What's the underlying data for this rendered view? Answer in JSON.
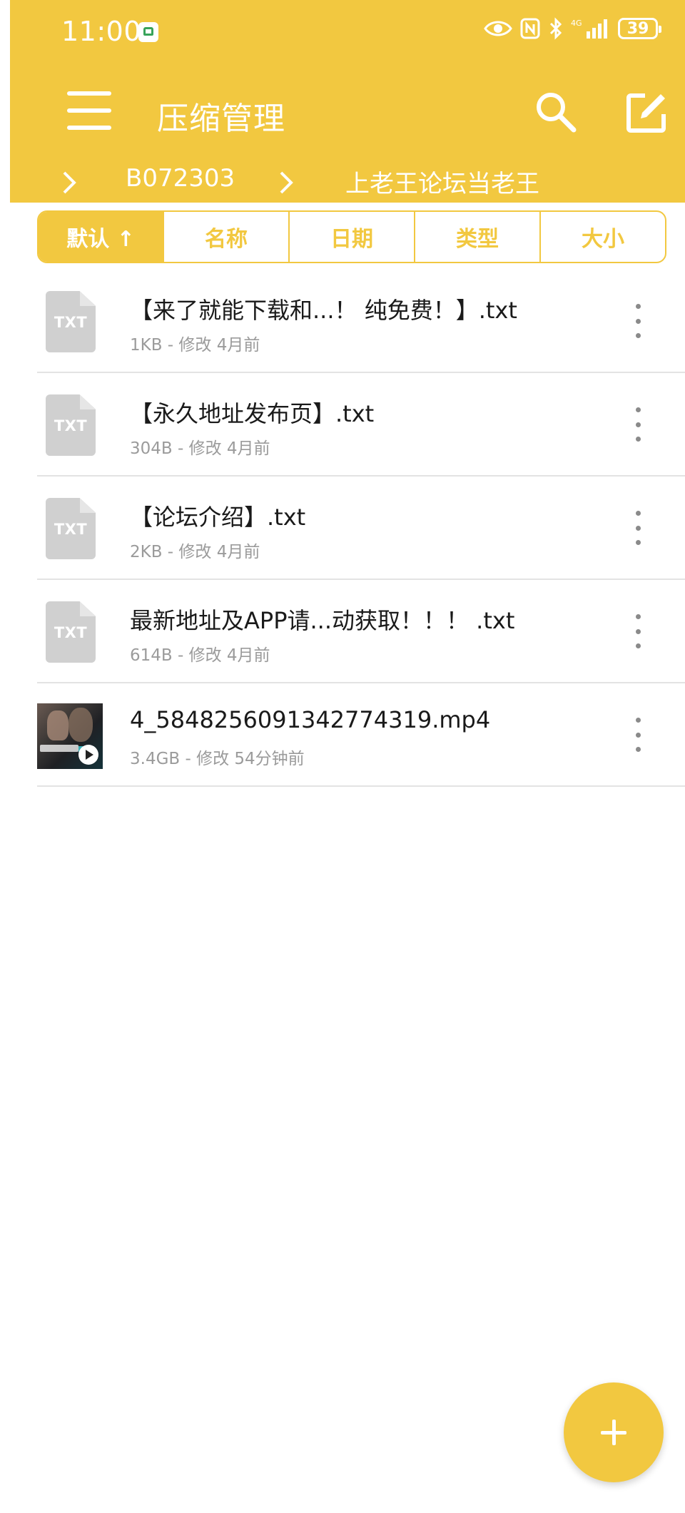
{
  "status_bar": {
    "time": "11:00",
    "battery": "39",
    "network": "4G",
    "icons": [
      "home-app-icon",
      "eye-icon",
      "nfc-icon",
      "bluetooth-icon",
      "signal-icon",
      "battery-icon"
    ]
  },
  "app_bar": {
    "title": "压缩管理",
    "menu_icon": "hamburger-menu-icon",
    "search_icon": "search-icon",
    "edit_icon": "edit-icon"
  },
  "breadcrumb": {
    "items": [
      "B072303",
      "上老王论坛当老王"
    ]
  },
  "sort_tabs": [
    {
      "label": "默认 ↑",
      "active": true
    },
    {
      "label": "名称",
      "active": false
    },
    {
      "label": "日期",
      "active": false
    },
    {
      "label": "类型",
      "active": false
    },
    {
      "label": "大小",
      "active": false
    }
  ],
  "files": [
    {
      "name": "【来了就能下载和...！ 纯免费！】.txt",
      "meta": "1KB - 修改 4月前",
      "type": "TXT"
    },
    {
      "name": "【永久地址发布页】.txt",
      "meta": "304B - 修改 4月前",
      "type": "TXT"
    },
    {
      "name": "【论坛介绍】.txt",
      "meta": "2KB - 修改 4月前",
      "type": "TXT"
    },
    {
      "name": "最新地址及APP请...动获取！！！ .txt",
      "meta": "614B - 修改 4月前",
      "type": "TXT"
    },
    {
      "name": "4_5848256091342774319.mp4",
      "meta": "3.4GB - 修改 54分钟前",
      "type": "video"
    }
  ],
  "fab": {
    "icon": "plus-icon"
  },
  "colors": {
    "accent": "#f2c840",
    "text": "#1a1a1a",
    "meta": "#9b9b9b",
    "divider": "#e3e3e3"
  }
}
